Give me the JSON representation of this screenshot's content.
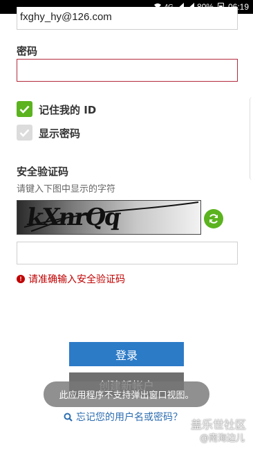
{
  "status_bar": {
    "battery": "80%",
    "time": "06:19",
    "network": "4G"
  },
  "form": {
    "email_value": "fxghy_hy@126.com",
    "password_label": "密码",
    "password_value": "",
    "remember_label": "记住我的 ID",
    "show_password_label": "显示密码",
    "captcha_title": "安全验证码",
    "captcha_hint": "请键入下图中显示的字符",
    "captcha_image_text": "kXnrQq",
    "captcha_input_value": "",
    "error_message": "请准确输入安全验证码",
    "login_button": "登录",
    "create_account_button": "创建新帐户",
    "forgot_link": "忘记您的用户名或密码？"
  },
  "toast": {
    "message": "此应用程序不支持弹出窗口视图。"
  },
  "watermark": {
    "line1": "盖乐世社区",
    "line2": "@南海边儿"
  },
  "colors": {
    "accent_green": "#5bb31f",
    "error_red": "#c00000",
    "button_blue": "#2c7bc7",
    "link_blue": "#2b6cb0"
  },
  "icons": [
    "wifi-icon",
    "signal-icon",
    "battery-icon",
    "checkmark-icon",
    "refresh-icon",
    "error-icon",
    "search-icon"
  ]
}
